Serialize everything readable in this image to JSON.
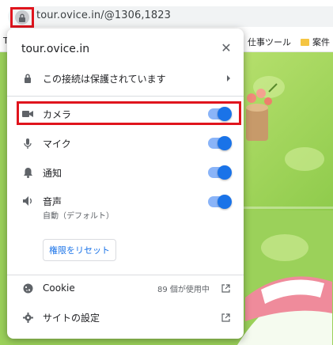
{
  "browser": {
    "url": "tour.ovice.in/@1306,1823",
    "bookmarks": [
      {
        "label": "仕事ツール",
        "icon": "bookmark-icon"
      },
      {
        "label": "案件",
        "icon": "folder-icon"
      }
    ],
    "bookmark_edge": "T"
  },
  "popup": {
    "title": "tour.ovice.in",
    "connection": {
      "label": "この接続は保護されています",
      "icon": "lock-icon"
    },
    "permissions": [
      {
        "label": "カメラ",
        "icon": "camera-icon",
        "enabled": true
      },
      {
        "label": "マイク",
        "icon": "microphone-icon",
        "enabled": true
      },
      {
        "label": "通知",
        "icon": "bell-icon",
        "enabled": true
      },
      {
        "label": "音声",
        "sublabel": "自動（デフォルト）",
        "icon": "speaker-icon",
        "enabled": true
      }
    ],
    "reset_button": "権限をリセット",
    "cookie": {
      "label": "Cookie",
      "usage": "89 個が使用中",
      "icon": "cookie-icon"
    },
    "site_settings": {
      "label": "サイトの設定",
      "icon": "gear-icon"
    }
  },
  "colors": {
    "accent": "#1a73e8",
    "highlight": "#e0141d",
    "scene_green": "#9bd15a"
  }
}
